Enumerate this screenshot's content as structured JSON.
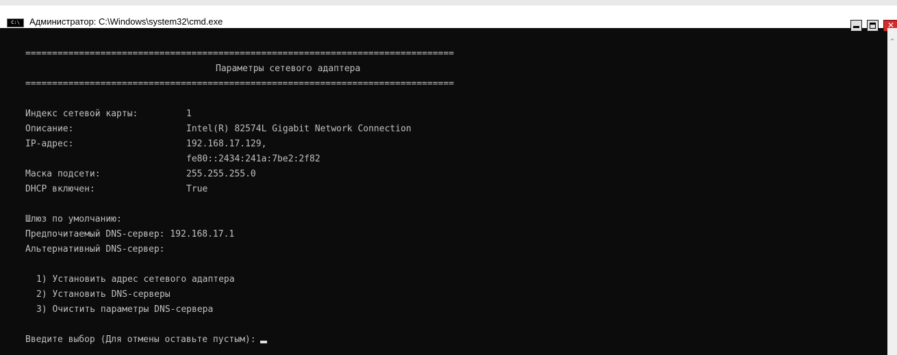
{
  "window": {
    "icon_text": "C:\\",
    "title": "Администратор: C:\\Windows\\system32\\cmd.exe",
    "minimize_symbol": "_",
    "maximize_symbol": "□",
    "close_symbol": "✕",
    "scroll_up_symbol": "^"
  },
  "console": {
    "separator_top": "================================================================================",
    "heading": "Параметры сетевого адаптера",
    "separator_bottom": "================================================================================",
    "adapter_index": {
      "label": "Индекс сетевой карты:",
      "value": "1"
    },
    "description": {
      "label": "Описание:",
      "value": "Intel(R) 82574L Gigabit Network Connection"
    },
    "ip_address": {
      "label": "IP-адрес:",
      "value": "192.168.17.129,",
      "value2": "fe80::2434:241a:7be2:2f82"
    },
    "subnet_mask": {
      "label": "Маска подсети:",
      "value": "255.255.255.0"
    },
    "dhcp": {
      "label": "DHCP включен:",
      "value": "True"
    },
    "gateway": "Шлюз по умолчанию:",
    "preferred_dns": "Предпочитаемый DNS-сервер: 192.168.17.1",
    "alternate_dns": "Альтернативный DNS-сервер:",
    "menu": [
      "1) Установить адрес сетевого адаптера",
      "2) Установить DNS-серверы",
      "3) Очистить параметры DNS-сервера"
    ],
    "prompt": "Введите выбор (Для отмены оставьте пустым):"
  }
}
